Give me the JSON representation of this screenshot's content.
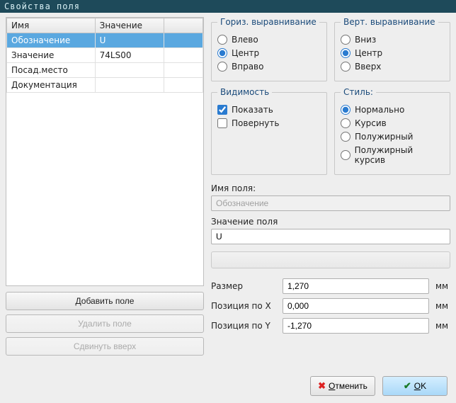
{
  "window": {
    "title": "Свойства поля"
  },
  "table": {
    "headers": {
      "name": "Имя",
      "value": "Значение"
    },
    "rows": [
      {
        "name": "Обозначение",
        "value": "U",
        "selected": true
      },
      {
        "name": "Значение",
        "value": "74LS00",
        "selected": false
      },
      {
        "name": "Посад.место",
        "value": "",
        "selected": false
      },
      {
        "name": "Документация",
        "value": "",
        "selected": false
      }
    ]
  },
  "buttons": {
    "add": "Добавить поле",
    "delete": "Удалить поле",
    "moveup": "Сдвинуть вверх",
    "cancel": "Отменить",
    "ok": "OK"
  },
  "groups": {
    "halign": {
      "legend": "Гориз. выравнивание",
      "left": "Влево",
      "center": "Центр",
      "right": "Вправо",
      "value": "center"
    },
    "valign": {
      "legend": "Верт. выравнивание",
      "down": "Вниз",
      "center": "Центр",
      "up": "Вверх",
      "value": "center"
    },
    "visibility": {
      "legend": "Видимость",
      "show": "Показать",
      "rotate": "Повернуть",
      "show_checked": true,
      "rotate_checked": false
    },
    "style": {
      "legend": "Стиль:",
      "normal": "Нормально",
      "italic": "Курсив",
      "bold": "Полужирный",
      "bolditalic": "Полужирный курсив",
      "value": "normal"
    }
  },
  "fields": {
    "name_label": "Имя поля:",
    "name_value": "Обозначение",
    "value_label": "Значение поля",
    "value_value": "U",
    "size_label": "Размер",
    "size_value": "1,270",
    "posx_label": "Позиция по X",
    "posx_value": "0,000",
    "posy_label": "Позиция по Y",
    "posy_value": "-1,270",
    "unit": "мм"
  }
}
